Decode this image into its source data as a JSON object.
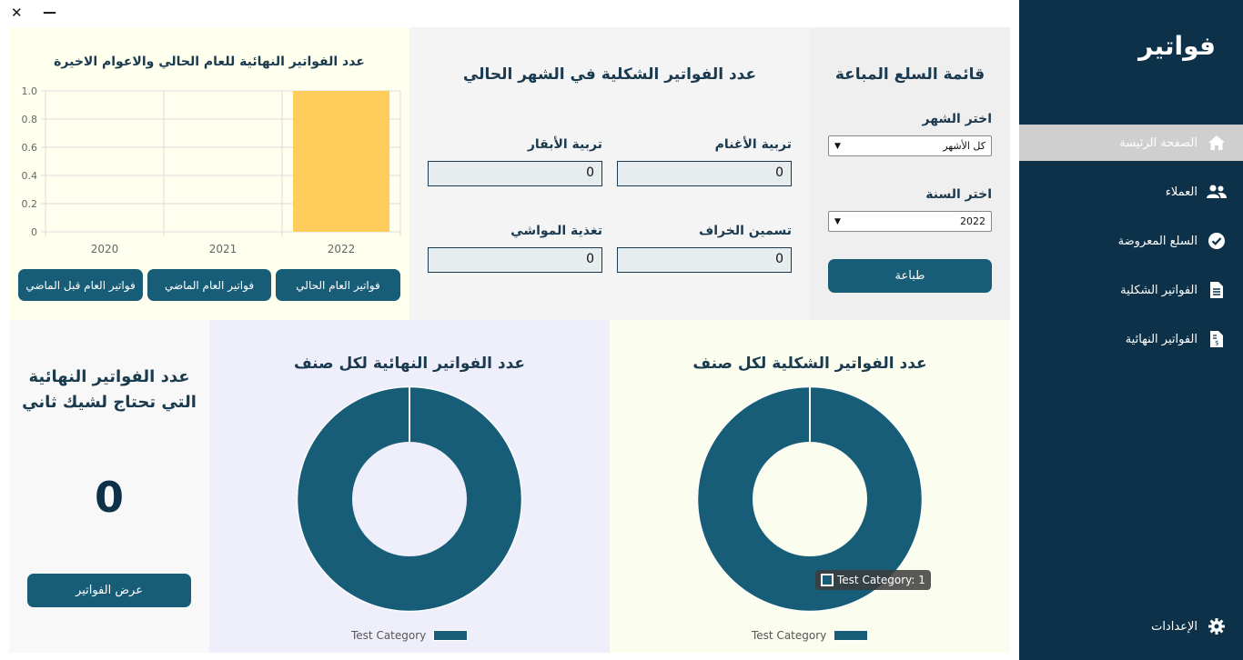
{
  "window": {
    "close": "✕",
    "minimize": "—"
  },
  "sidebar": {
    "brand": "فواتير",
    "items": [
      {
        "label": "الصفحة الرئيسة",
        "icon": "home-icon"
      },
      {
        "label": "العملاء",
        "icon": "users-icon"
      },
      {
        "label": "السلع المعروضة",
        "icon": "check-circle-icon"
      },
      {
        "label": "الفواتير الشكلية",
        "icon": "document-icon"
      },
      {
        "label": "الفواتير النهائية",
        "icon": "invoice-icon"
      }
    ],
    "settings": {
      "label": "الإعدادات",
      "icon": "gear-icon"
    }
  },
  "sold_goods": {
    "title": "قائمة السلع المباعة",
    "month_label": "اختر الشهر",
    "month_value": "كل الأشهر",
    "year_label": "اختر السنة",
    "year_value": "2022",
    "print_button": "طباعة"
  },
  "proforma_month": {
    "title": "عدد الفواتير الشكلية في الشهر الحالي",
    "fields": [
      {
        "label": "تربية الأغنام",
        "value": "0"
      },
      {
        "label": "تربية الأبقار",
        "value": "0"
      },
      {
        "label": "تسمين الخراف",
        "value": "0"
      },
      {
        "label": "تغذية المواشي",
        "value": "0"
      }
    ]
  },
  "final_years": {
    "title": "عدد الفواتير النهائية للعام الحالي والاعوام الاخيرة",
    "buttons": [
      "فواتير العام الحالي",
      "فواتير العام الماضي",
      "فواتير العام قبل الماضي"
    ]
  },
  "second_check": {
    "title_line1": "عدد الفواتير النهائية",
    "title_line2": "التي تحتاج لشيك ثاني",
    "count": "0",
    "button": "عرض الفواتير"
  },
  "final_by_category": {
    "title": "عدد الفواتير النهائية لكل صنف",
    "legend": "Test Category"
  },
  "proforma_by_category": {
    "title": "عدد الفواتير الشكلية لكل صنف",
    "legend": "Test Category",
    "tooltip": "Test Category: 1"
  },
  "colors": {
    "sidebar_bg": "#0c3148",
    "accent": "#175d78",
    "bar": "#ffcd5b",
    "panel_yellow": "#ffffee",
    "panel_gray": "#f4f4f4",
    "panel_lavender": "#efeffc"
  },
  "chart_data": [
    {
      "type": "bar",
      "title": "عدد الفواتير النهائية للعام الحالي والاعوام الاخيرة",
      "categories": [
        "2020",
        "2021",
        "2022"
      ],
      "values": [
        0,
        0,
        1
      ],
      "ylim": [
        0,
        1.0
      ],
      "yticks": [
        "0",
        "0.2",
        "0.4",
        "0.6",
        "0.8",
        "1.0"
      ],
      "grid": true
    },
    {
      "type": "pie",
      "variant": "doughnut",
      "title": "عدد الفواتير النهائية لكل صنف",
      "categories": [
        "Test Category"
      ],
      "values": [
        1
      ],
      "legend": "bottom"
    },
    {
      "type": "pie",
      "variant": "doughnut",
      "title": "عدد الفواتير الشكلية لكل صنف",
      "categories": [
        "Test Category"
      ],
      "values": [
        1
      ],
      "legend": "bottom"
    }
  ]
}
